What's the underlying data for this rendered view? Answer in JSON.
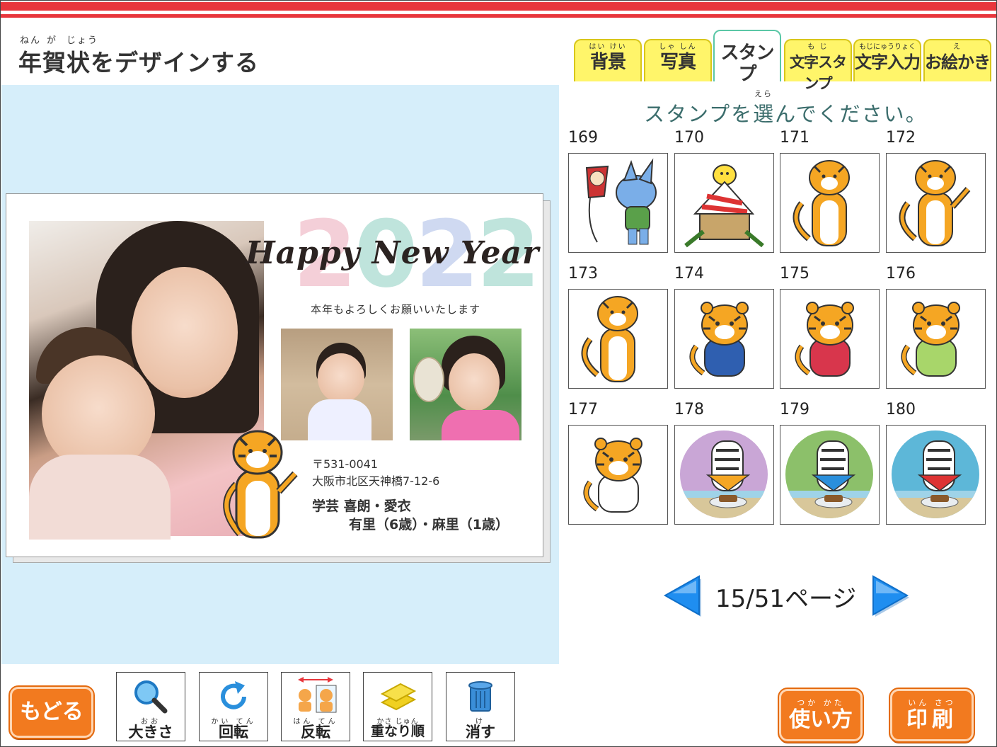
{
  "header": {
    "title": "年賀状をデザインする",
    "title_ruby": [
      "ねん",
      "が",
      "じょう"
    ]
  },
  "card": {
    "year": [
      "2",
      "0",
      "2",
      "2"
    ],
    "greeting_title": "Happy New Year",
    "greeting_text": "本年もよろしくお願いいたします",
    "postal_code": "〒531-0041",
    "address": "大阪市北区天神橋7-12-6",
    "name_line1": "学芸 喜朗・愛衣",
    "name_line2": "有里（6歳）・麻里（1歳）"
  },
  "tabs": [
    {
      "label": "背景",
      "ruby": "はい けい",
      "active": false
    },
    {
      "label": "写真",
      "ruby": "しゃ しん",
      "active": false
    },
    {
      "label": "スタンプ",
      "ruby": "",
      "active": true
    },
    {
      "label": "文字スタンプ",
      "ruby": "も じ",
      "active": false
    },
    {
      "label": "文字入力",
      "ruby": "もじにゅうりょく",
      "active": false
    },
    {
      "label": "お絵かき",
      "ruby": "え",
      "active": false
    }
  ],
  "stamp_panel": {
    "prompt": "スタンプを選んでください。",
    "prompt_ruby": "えら",
    "stamps": [
      {
        "number": "169",
        "icon": "cat-with-kite-icon"
      },
      {
        "number": "170",
        "icon": "chick-kadomatsu-icon"
      },
      {
        "number": "171",
        "icon": "tiger-standing-icon"
      },
      {
        "number": "172",
        "icon": "tiger-waving-icon"
      },
      {
        "number": "173",
        "icon": "tiger-sitting-icon"
      },
      {
        "number": "174",
        "icon": "tiger-hakama-icon"
      },
      {
        "number": "175",
        "icon": "tiger-kimono-icon"
      },
      {
        "number": "176",
        "icon": "tiger-green-kimono-icon"
      },
      {
        "number": "177",
        "icon": "tiger-shrine-maiden-icon"
      },
      {
        "number": "178",
        "icon": "white-tiger-purple-icon"
      },
      {
        "number": "179",
        "icon": "white-tiger-green-icon"
      },
      {
        "number": "180",
        "icon": "white-tiger-blue-icon"
      }
    ],
    "page_text": "15/51ページ"
  },
  "toolbar": {
    "back": "もどる",
    "tools": [
      {
        "label": "大きさ",
        "ruby": "おお",
        "icon": "magnifier-icon"
      },
      {
        "label": "回転",
        "ruby": "かい てん",
        "icon": "rotate-icon"
      },
      {
        "label": "反転",
        "ruby": "はん てん",
        "icon": "flip-icon"
      },
      {
        "label": "重なり順",
        "ruby": "かさ じゅん",
        "icon": "layers-icon"
      },
      {
        "label": "消す",
        "ruby": "け",
        "icon": "trash-icon"
      }
    ],
    "help": "使い方",
    "help_ruby": "つか かた",
    "print": "印刷",
    "print_ruby": "いん さつ"
  },
  "colors": {
    "accent_red": "#e8363c",
    "tab_yellow": "#fff56a",
    "button_orange": "#f27a1f",
    "canvas_bg": "#d6eefa",
    "arrow_blue": "#1f8ef0"
  }
}
